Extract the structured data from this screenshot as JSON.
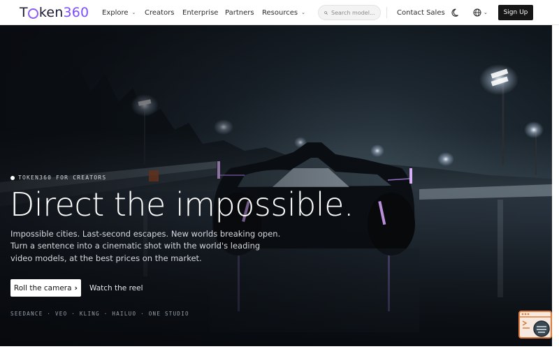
{
  "brand": {
    "prefix": "T",
    "middle": "ken",
    "suffix": "360"
  },
  "nav": {
    "links": [
      {
        "label": "Explore",
        "has_dropdown": true
      },
      {
        "label": "Creators",
        "has_dropdown": false
      },
      {
        "label": "Enterprise",
        "has_dropdown": false
      },
      {
        "label": "Partners",
        "has_dropdown": false
      },
      {
        "label": "Resources",
        "has_dropdown": true
      }
    ],
    "search_placeholder": "Search model...",
    "contact_label": "Contact Sales",
    "signup_label": "Sign Up",
    "icons": [
      "search-icon",
      "moon-icon",
      "globe-icon",
      "chevron-down-icon"
    ]
  },
  "hero": {
    "eyebrow": "TOKEN360 FOR CREATORS",
    "headline": "Direct the impossible.",
    "subtitle": "Impossible cities. Last-second escapes. New worlds breaking open. Turn a sentence into a cinematic shot with the world's leading video models, at the best prices on the market.",
    "primary_cta": "Roll the camera",
    "secondary_cta": "Watch the reel",
    "models_line": "SEEDANCE · VEO · KLING · HAILUO · ONE STUDIO"
  },
  "colors": {
    "accent": "#7c4dff",
    "signup_bg": "#161616",
    "widget_orange": "#e07a3a"
  }
}
